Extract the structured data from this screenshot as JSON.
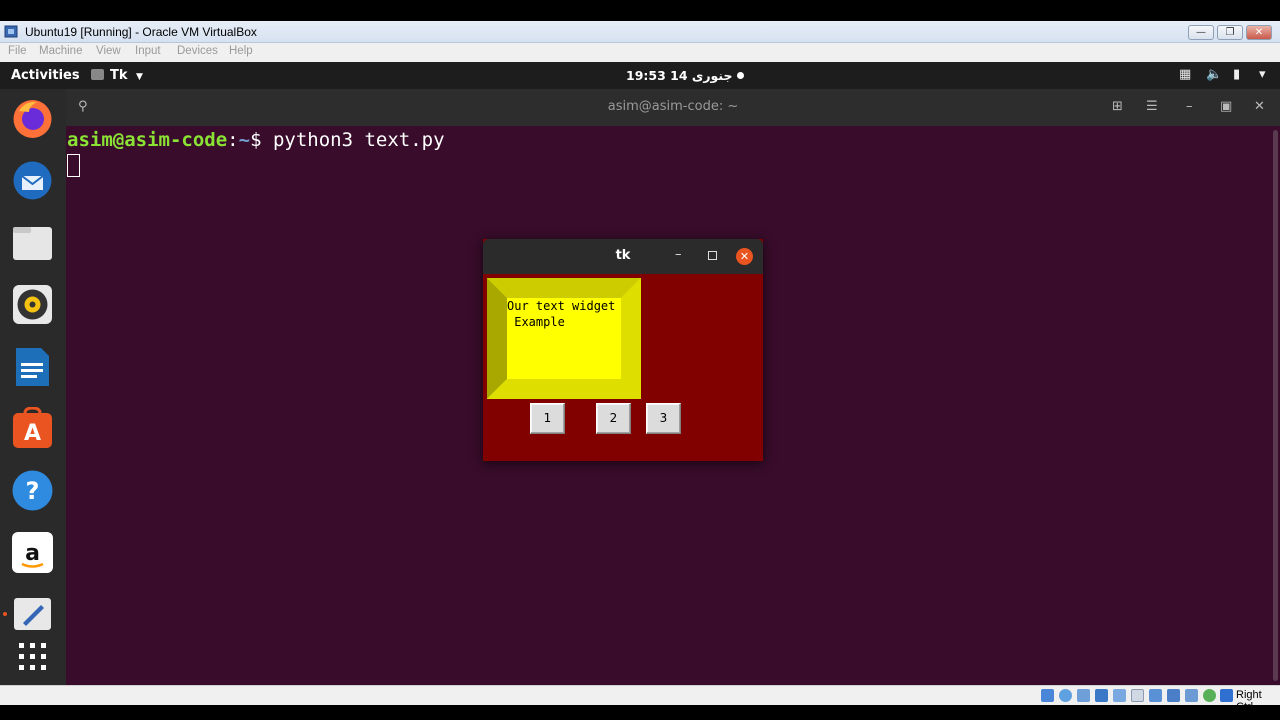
{
  "vbox": {
    "title": "Ubuntu19 [Running] - Oracle VM VirtualBox",
    "menu": [
      "File",
      "Machine",
      "View",
      "Input",
      "Devices",
      "Help"
    ],
    "host_key_label": "Right Ctrl"
  },
  "topbar": {
    "activities": "Activities",
    "app_menu": "Tk",
    "clock": "19:53  14 جنوری"
  },
  "dock": {
    "apps": [
      {
        "name": "firefox-icon",
        "color": "#ff7139"
      },
      {
        "name": "thunderbird-icon",
        "color": "#1f6bbf"
      },
      {
        "name": "files-icon",
        "color": "#e6e6e6"
      },
      {
        "name": "rhythmbox-icon",
        "color": "#f5c211"
      },
      {
        "name": "libreoffice-writer-icon",
        "color": "#1c6fb8"
      },
      {
        "name": "ubuntu-software-icon",
        "color": "#e95420"
      },
      {
        "name": "help-icon",
        "color": "#2f8be0"
      },
      {
        "name": "amazon-icon",
        "color": "#ffffff"
      },
      {
        "name": "text-editor-icon",
        "color": "#e8e8e8"
      },
      {
        "name": "show-applications-icon",
        "color": "#ffffff"
      }
    ]
  },
  "terminal": {
    "title": "asim@asim-code: ~",
    "prompt_user": "asim@asim-code",
    "prompt_sep": ":",
    "prompt_path": "~",
    "prompt_symbol": "$ ",
    "command": "python3 text.py"
  },
  "tk_window": {
    "title": "tk",
    "text_widget_content": "Our text widget\n Example",
    "background": "#810000",
    "text_bg": "#ffff00",
    "buttons": [
      "1",
      "2",
      "3"
    ]
  }
}
